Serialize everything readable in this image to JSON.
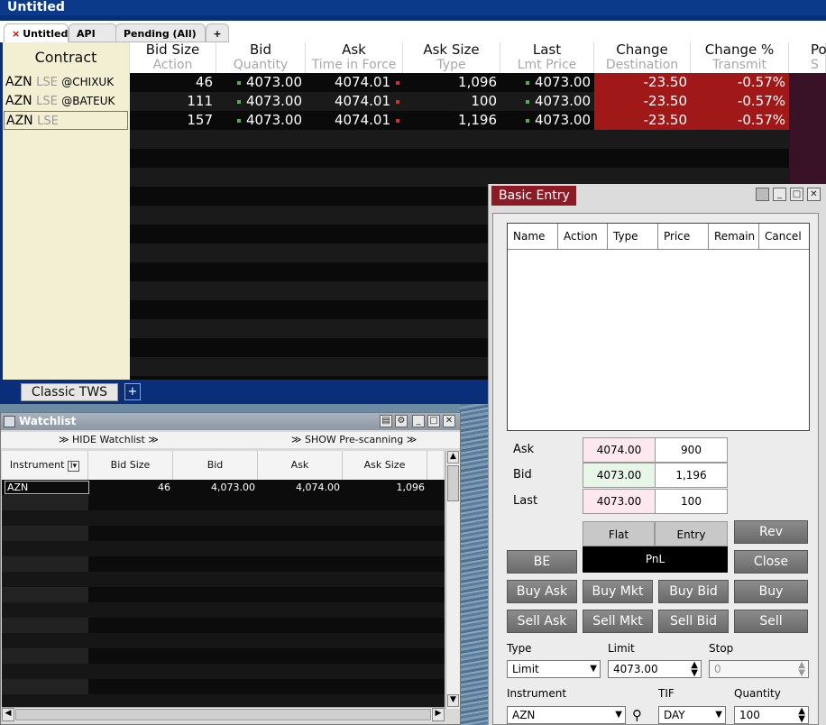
{
  "main_window": {
    "title": "Untitled",
    "tabs": [
      {
        "label": "Untitled",
        "close": "×"
      },
      {
        "label": "API"
      },
      {
        "label": "Pending (All)"
      },
      {
        "label": "+"
      }
    ],
    "columns": [
      {
        "title": "Contract",
        "sub": ""
      },
      {
        "title": "Bid Size",
        "sub": "Action"
      },
      {
        "title": "Bid",
        "sub": "Quantity"
      },
      {
        "title": "Ask",
        "sub": "Time in Force"
      },
      {
        "title": "Ask Size",
        "sub": "Type"
      },
      {
        "title": "Last",
        "sub": "Lmt Price"
      },
      {
        "title": "Change",
        "sub": "Destination"
      },
      {
        "title": "Change %",
        "sub": "Transmit"
      },
      {
        "title": "Po",
        "sub": "S"
      }
    ],
    "rows": [
      {
        "sym": "AZN",
        "exch": "LSE",
        "route": "@CHIXUK",
        "bid_size": "46",
        "bid": "4073.00",
        "ask": "4074.01",
        "ask_size": "1,096",
        "last": "4073.00",
        "change": "-23.50",
        "change_pct": "-0.57%"
      },
      {
        "sym": "AZN",
        "exch": "LSE",
        "route": "@BATEUK",
        "bid_size": "111",
        "bid": "4073.00",
        "ask": "4074.01",
        "ask_size": "100",
        "last": "4073.00",
        "change": "-23.50",
        "change_pct": "-0.57%"
      },
      {
        "sym": "AZN",
        "exch": "LSE",
        "route": "",
        "bid_size": "157",
        "bid": "4073.00",
        "ask": "4074.01",
        "ask_size": "1,196",
        "last": "4073.00",
        "change": "-23.50",
        "change_pct": "-0.57%"
      }
    ],
    "bottom_tabs": {
      "classic": "Classic TWS",
      "add": "+"
    }
  },
  "watchlist": {
    "title": "Watchlist",
    "hide_label": "HIDE Watchlist",
    "show_label": "SHOW Pre-scanning",
    "columns": [
      "Instrument",
      "Bid Size",
      "Bid",
      "Ask",
      "Ask Size"
    ],
    "rows": [
      {
        "instrument": "AZN",
        "bid_size": "46",
        "bid": "4,073.00",
        "ask": "4,074.00",
        "ask_size": "1,096"
      }
    ]
  },
  "basic_entry": {
    "title": "Basic Entry",
    "order_columns": [
      "Name",
      "Action",
      "Type",
      "Price",
      "Remain",
      "Cancel"
    ],
    "quotes": [
      {
        "label": "Ask",
        "price": "4074.00",
        "size": "900"
      },
      {
        "label": "Bid",
        "price": "4073.00",
        "size": "1,196"
      },
      {
        "label": "Last",
        "price": "4073.00",
        "size": "100"
      }
    ],
    "flat_label": "Flat",
    "entry_label": "Entry",
    "pnl_label": "PnL",
    "buttons": {
      "rev": "Rev",
      "be": "BE",
      "close": "Close",
      "buy_ask": "Buy Ask",
      "buy_mkt": "Buy Mkt",
      "buy_bid": "Buy Bid",
      "buy": "Buy",
      "sell_ask": "Sell Ask",
      "sell_mkt": "Sell Mkt",
      "sell_bid": "Sell Bid",
      "sell": "Sell"
    },
    "labels": {
      "type": "Type",
      "limit": "Limit",
      "stop": "Stop",
      "instrument": "Instrument",
      "tif": "TIF",
      "quantity": "Quantity"
    },
    "values": {
      "type": "Limit",
      "limit": "4073.00",
      "stop": "0",
      "instrument": "AZN",
      "tif": "DAY",
      "quantity": "100"
    }
  },
  "colors": {
    "change_bg": "#a01818",
    "title_bar": "#0b3a8a",
    "entry_tab": "#8c1b25"
  }
}
